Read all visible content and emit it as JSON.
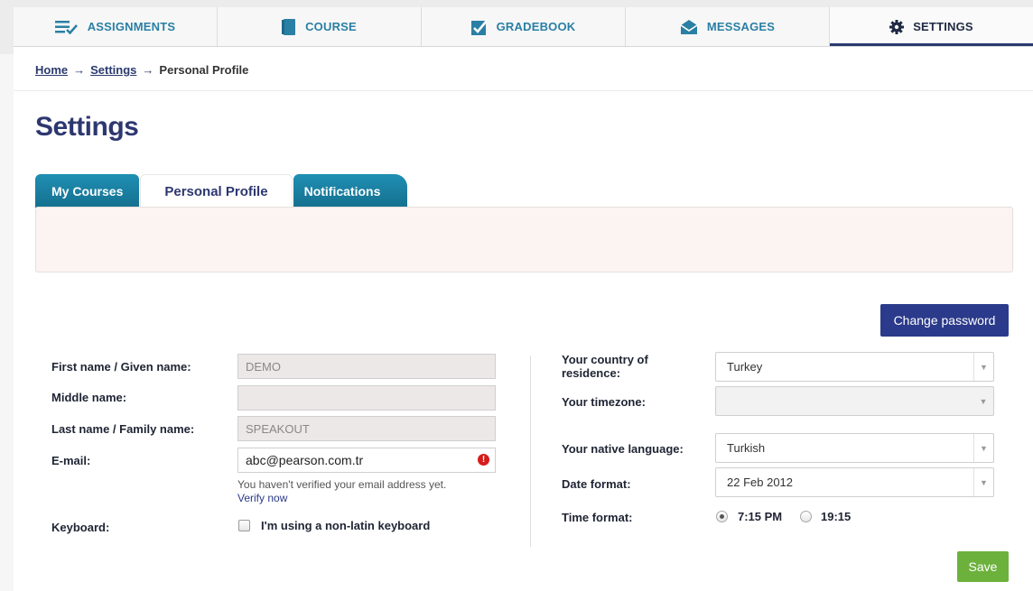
{
  "nav": {
    "tabs": [
      {
        "label": "ASSIGNMENTS",
        "icon": "list-check-icon"
      },
      {
        "label": "COURSE",
        "icon": "book-icon"
      },
      {
        "label": "GRADEBOOK",
        "icon": "checkbox-icon"
      },
      {
        "label": "MESSAGES",
        "icon": "envelope-icon"
      },
      {
        "label": "SETTINGS",
        "icon": "gear-icon"
      }
    ],
    "active": "SETTINGS"
  },
  "breadcrumb": {
    "home": "Home",
    "settings": "Settings",
    "current": "Personal Profile",
    "separator": "→"
  },
  "page": {
    "title": "Settings"
  },
  "tabs": {
    "my_courses": "My Courses",
    "personal_profile": "Personal Profile",
    "notifications": "Notifications"
  },
  "buttons": {
    "change_password": "Change password",
    "save": "Save"
  },
  "profile": {
    "first_name_label": "First name / Given name:",
    "first_name_value": "DEMO",
    "middle_name_label": "Middle name:",
    "middle_name_value": "",
    "last_name_label": "Last name / Family name:",
    "last_name_value": "SPEAKOUT",
    "email_label": "E-mail:",
    "email_value": "abc@pearson.com.tr",
    "email_error_icon": "!",
    "email_hint": "You haven't verified your email address yet.",
    "verify_link": "Verify now",
    "keyboard_label": "Keyboard:",
    "keyboard_checkbox_label": "I'm using a non-latin keyboard"
  },
  "preferences": {
    "country_label_line1": "Your country of",
    "country_label_line2": "residence:",
    "country_value": "Turkey",
    "timezone_label": "Your timezone:",
    "timezone_value": "",
    "language_label": "Your native language:",
    "language_value": "Turkish",
    "date_format_label": "Date format:",
    "date_format_value": "22 Feb 2012",
    "time_format_label": "Time format:",
    "time_format_options": [
      "7:15 PM",
      "19:15"
    ],
    "time_format_selected": "7:15 PM"
  },
  "colors": {
    "nav_text": "#2a7fa4",
    "title": "#2d3770",
    "tab_blue": "#1f8fb3",
    "primary_button": "#2b3a8a",
    "save_button": "#6cb13c",
    "error": "#d51d1d"
  }
}
